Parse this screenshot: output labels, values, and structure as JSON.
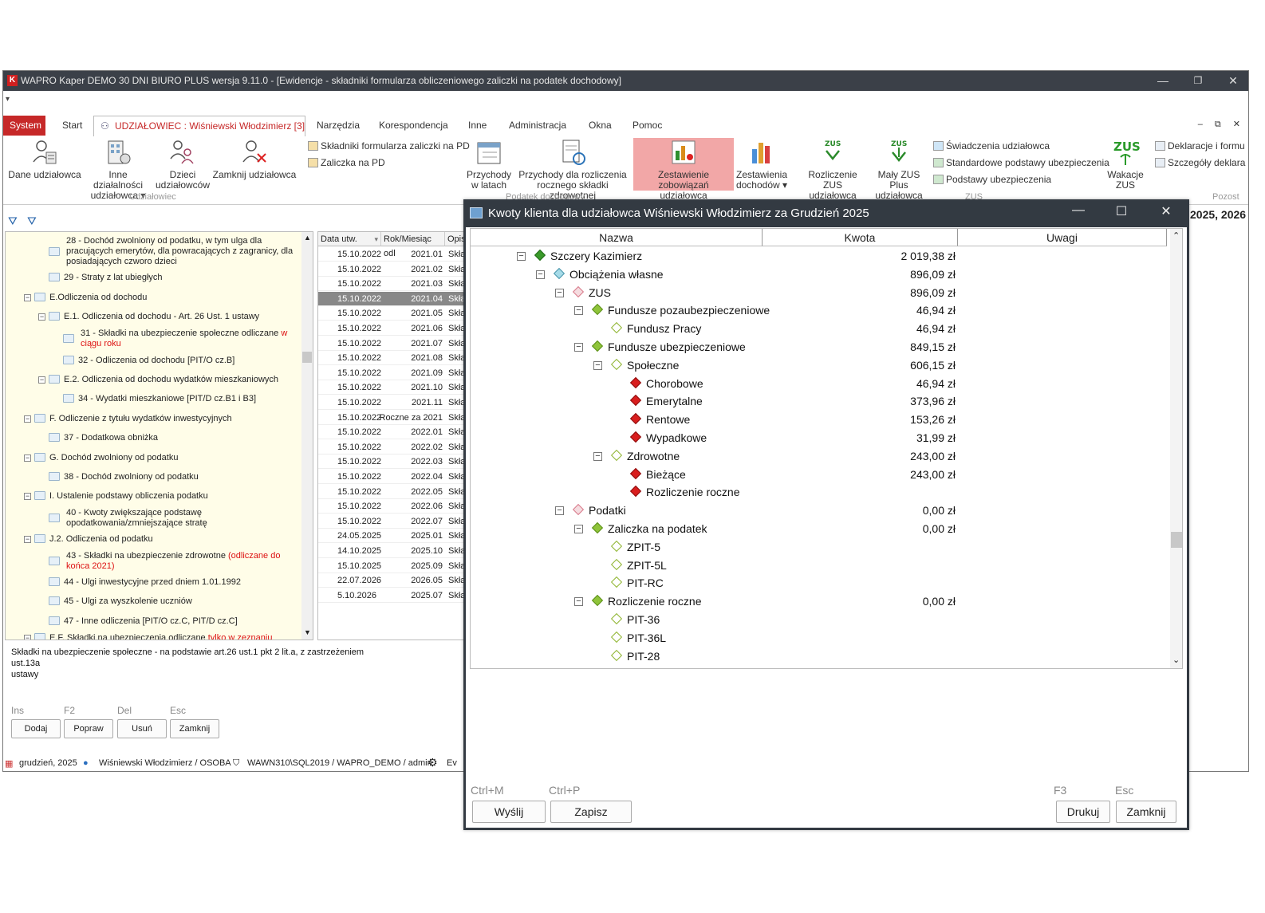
{
  "window": {
    "title": "WAPRO Kaper DEMO 30 DNI BIURO PLUS wersja 9.11.0 - [Ewidencje - składniki formularza obliczeniowego zaliczki na podatek dochodowy]",
    "app_icon": "K"
  },
  "menu": {
    "system": "System",
    "start": "Start",
    "udzialowiec": "UDZIAŁOWIEC : Wiśniewski Włodzimierz [3]",
    "narzedzia": "Narzędzia",
    "korespondencja": "Korespondencja",
    "inne": "Inne",
    "administracja": "Administracja",
    "okna": "Okna",
    "pomoc": "Pomoc"
  },
  "ribbon": {
    "dane": "Dane udziałowca",
    "inne_dzialalnosci_1": "Inne działalności",
    "inne_dzialalnosci_2": "udziałowca ▾",
    "dzieci_1": "Dzieci",
    "dzieci_2": "udziałowców",
    "zamknij": "Zamknij udziałowca",
    "group_udzialowiec": "Udziałowiec",
    "skladniki": "Składniki formularza zaliczki na PD",
    "zaliczka_pd": "Zaliczka na PD",
    "przychody_latach_1": "Przychody",
    "przychody_latach_2": "w latach",
    "przychody_rozl_1": "Przychody dla rozliczenia",
    "przychody_rozl_2": "rocznego składki zdrowotnej",
    "zestawienie_1": "Zestawienie",
    "zestawienie_2": "zobowiązań udziałowca",
    "zestawienia_doch_1": "Zestawienia",
    "zestawienia_doch_2": "dochodów ▾",
    "group_podatek": "Podatek dochodowy",
    "rozliczenie_zus_1": "Rozliczenie",
    "rozliczenie_zus_2": "ZUS udziałowca",
    "maly_zus_1": "Mały ZUS Plus",
    "maly_zus_2": "udziałowca",
    "swiadczenia": "Świadczenia udziałowca",
    "standardowe": "Standardowe podstawy ubezpieczenia",
    "podstawy": "Podstawy ubezpieczenia",
    "group_zus": "ZUS",
    "wakacje_1": "Wakacje",
    "wakacje_2": "ZUS",
    "deklaracje": "Deklaracje i formu",
    "szczegoly": "Szczegóły deklara",
    "group_pozost": "Pozost",
    "zus_label": "ZUS"
  },
  "tree": {
    "items": [
      {
        "l1": "28 - Dochód zwolniony od podatku, w tym ulga dla",
        "l2": "pracujących emerytów, dla powracających z zagranicy, dla",
        "l3": "posiadających czworo dzieci"
      },
      {
        "l1": "29 - Straty z lat ubiegłych"
      },
      {
        "l1": "E.Odliczenia od dochodu"
      },
      {
        "l1": "E.1. Odliczenia od dochodu - Art. 26 Ust. 1 ustawy"
      },
      {
        "l1": "31 - Składki na ubezpieczenie społeczne odliczane ",
        "red1": "w",
        "red2": "ciągu roku"
      },
      {
        "l1": "32 - Odliczenia od dochodu [PIT/O cz.B]"
      },
      {
        "l1": "E.2. Odliczenia od dochodu wydatków mieszkaniowych"
      },
      {
        "l1": "34 - Wydatki mieszkaniowe [PIT/D cz.B1 i B3]"
      },
      {
        "l1": "F. Odliczenie z tytułu wydatków inwestycyjnych"
      },
      {
        "l1": "37 - Dodatkowa obniżka"
      },
      {
        "l1": "G. Dochód zwolniony od podatku"
      },
      {
        "l1": "38 - Dochód zwolniony od podatku"
      },
      {
        "l1": "I. Ustalenie podstawy obliczenia podatku"
      },
      {
        "l1": "40 - Kwoty zwiększające podstawę",
        "l2": "opodatkowania/zmniejszające stratę"
      },
      {
        "l1": "J.2. Odliczenia od podatku"
      },
      {
        "l1": "43 - Składki na ubezpieczenie zdrowotne ",
        "red1": "(odliczane do",
        "red2": "końca 2021)"
      },
      {
        "l1": "44 - Ulgi inwestycyjne przed dniem 1.01.1992"
      },
      {
        "l1": "45 - Ulgi za wyszkolenie uczniów"
      },
      {
        "l1": "47 - Inne odliczenia [PIT/O cz.C, PIT/D cz.C]"
      },
      {
        "l1": "E.F. Składki na ubezpieczenia odliczane ",
        "red1": "tylko w zeznaniu"
      }
    ]
  },
  "grid": {
    "headers": [
      "Data utw.",
      "Rok/Miesiąc odl",
      "Opis"
    ],
    "rows": [
      [
        "15.10.2022",
        "2021.01",
        "Skład"
      ],
      [
        "15.10.2022",
        "2021.02",
        "Skład"
      ],
      [
        "15.10.2022",
        "2021.03",
        "Skład"
      ],
      [
        "15.10.2022",
        "2021.04",
        "Skład"
      ],
      [
        "15.10.2022",
        "2021.05",
        "Skład"
      ],
      [
        "15.10.2022",
        "2021.06",
        "Skład"
      ],
      [
        "15.10.2022",
        "2021.07",
        "Skład"
      ],
      [
        "15.10.2022",
        "2021.08",
        "Skład"
      ],
      [
        "15.10.2022",
        "2021.09",
        "Skład"
      ],
      [
        "15.10.2022",
        "2021.10",
        "Skład"
      ],
      [
        "15.10.2022",
        "2021.11",
        "Skład"
      ],
      [
        "15.10.2022",
        "Roczne za 2021",
        "Skład"
      ],
      [
        "15.10.2022",
        "2022.01",
        "Skład"
      ],
      [
        "15.10.2022",
        "2022.02",
        "Skład"
      ],
      [
        "15.10.2022",
        "2022.03",
        "Skład"
      ],
      [
        "15.10.2022",
        "2022.04",
        "Skład"
      ],
      [
        "15.10.2022",
        "2022.05",
        "Skład"
      ],
      [
        "15.10.2022",
        "2022.06",
        "Skład"
      ],
      [
        "15.10.2022",
        "2022.07",
        "Skład"
      ],
      [
        "24.05.2025",
        "2025.01",
        "Skład"
      ],
      [
        "14.10.2025",
        "2025.10",
        "Skład"
      ],
      [
        "15.10.2025",
        "2025.09",
        "Skład"
      ],
      [
        "22.07.2026",
        "2026.05",
        "Skład"
      ],
      [
        "5.10.2026",
        "2025.07",
        "Skład"
      ]
    ],
    "selected_index": 3
  },
  "description": {
    "line1": "Składki na ubezpieczenie społeczne - na podstawie art.26 ust.1 pkt 2 lit.a, z zastrzeżeniem ust.13a",
    "line2": "ustawy"
  },
  "footer": {
    "keys": [
      "Ins",
      "F2",
      "Del",
      "Esc"
    ],
    "buttons": [
      "Dodaj",
      "Popraw",
      "Usuń",
      "Zamknij"
    ]
  },
  "status": {
    "period": "grudzień, 2025",
    "user": "Wiśniewski Włodzimierz / OSOBA",
    "server": "WAWN310\\SQL2019 / WAPRO_DEMO / admin",
    "ev": "Ev"
  },
  "right_fragment": "2025, 2026",
  "dialog": {
    "title": "Kwoty klienta dla udziałowca Wiśniewski Włodzimierz za Grudzień 2025",
    "columns": [
      "Nazwa",
      "Kwota",
      "Uwagi"
    ],
    "rows": [
      {
        "name": "Szczery Kazimierz",
        "amount": "2 019,38 zł",
        "icon": "green"
      },
      {
        "name": "Obciążenia własne",
        "amount": "896,09 zł",
        "icon": "lblue"
      },
      {
        "name": "ZUS",
        "amount": "896,09 zł",
        "icon": "pink"
      },
      {
        "name": "Fundusze pozaubezpieczeniowe",
        "amount": "46,94 zł",
        "icon": "lgreen"
      },
      {
        "name": "Fundusz Pracy",
        "amount": "46,94 zł",
        "icon": "hgreen"
      },
      {
        "name": "Fundusze ubezpieczeniowe",
        "amount": "849,15 zł",
        "icon": "lgreen"
      },
      {
        "name": "Społeczne",
        "amount": "606,15 zł",
        "icon": "hgreen"
      },
      {
        "name": "Chorobowe",
        "amount": "46,94 zł",
        "icon": "red"
      },
      {
        "name": "Emerytalne",
        "amount": "373,96 zł",
        "icon": "red"
      },
      {
        "name": "Rentowe",
        "amount": "153,26 zł",
        "icon": "red"
      },
      {
        "name": "Wypadkowe",
        "amount": "31,99 zł",
        "icon": "red"
      },
      {
        "name": "Zdrowotne",
        "amount": "243,00 zł",
        "icon": "hgreen"
      },
      {
        "name": "Bieżące",
        "amount": "243,00 zł",
        "icon": "red"
      },
      {
        "name": "Rozliczenie roczne",
        "amount": "",
        "icon": "red"
      },
      {
        "name": "Podatki",
        "amount": "0,00 zł",
        "icon": "pink"
      },
      {
        "name": "Zaliczka na podatek",
        "amount": "0,00 zł",
        "icon": "lgreen"
      },
      {
        "name": "ZPIT-5",
        "amount": "",
        "icon": "hgreen"
      },
      {
        "name": "ZPIT-5L",
        "amount": "",
        "icon": "hgreen"
      },
      {
        "name": "PIT-RC",
        "amount": "",
        "icon": "hgreen"
      },
      {
        "name": "Rozliczenie roczne",
        "amount": "0,00 zł",
        "icon": "lgreen"
      },
      {
        "name": "PIT-36",
        "amount": "",
        "icon": "hgreen"
      },
      {
        "name": "PIT-36L",
        "amount": "",
        "icon": "hgreen"
      },
      {
        "name": "PIT-28",
        "amount": "",
        "icon": "hgreen"
      }
    ],
    "keys": {
      "send": "Ctrl+M",
      "save": "Ctrl+P",
      "print": "F3",
      "close": "Esc"
    },
    "buttons": {
      "send": "Wyślij",
      "save": "Zapisz",
      "print": "Drukuj",
      "close": "Zamknij"
    }
  },
  "colors": {
    "accent": "#c62828",
    "titlebar": "#3b4048",
    "dialog_titlebar": "#333a42",
    "highlight": "#f2a7a7",
    "tree_bg": "#fffde8"
  }
}
